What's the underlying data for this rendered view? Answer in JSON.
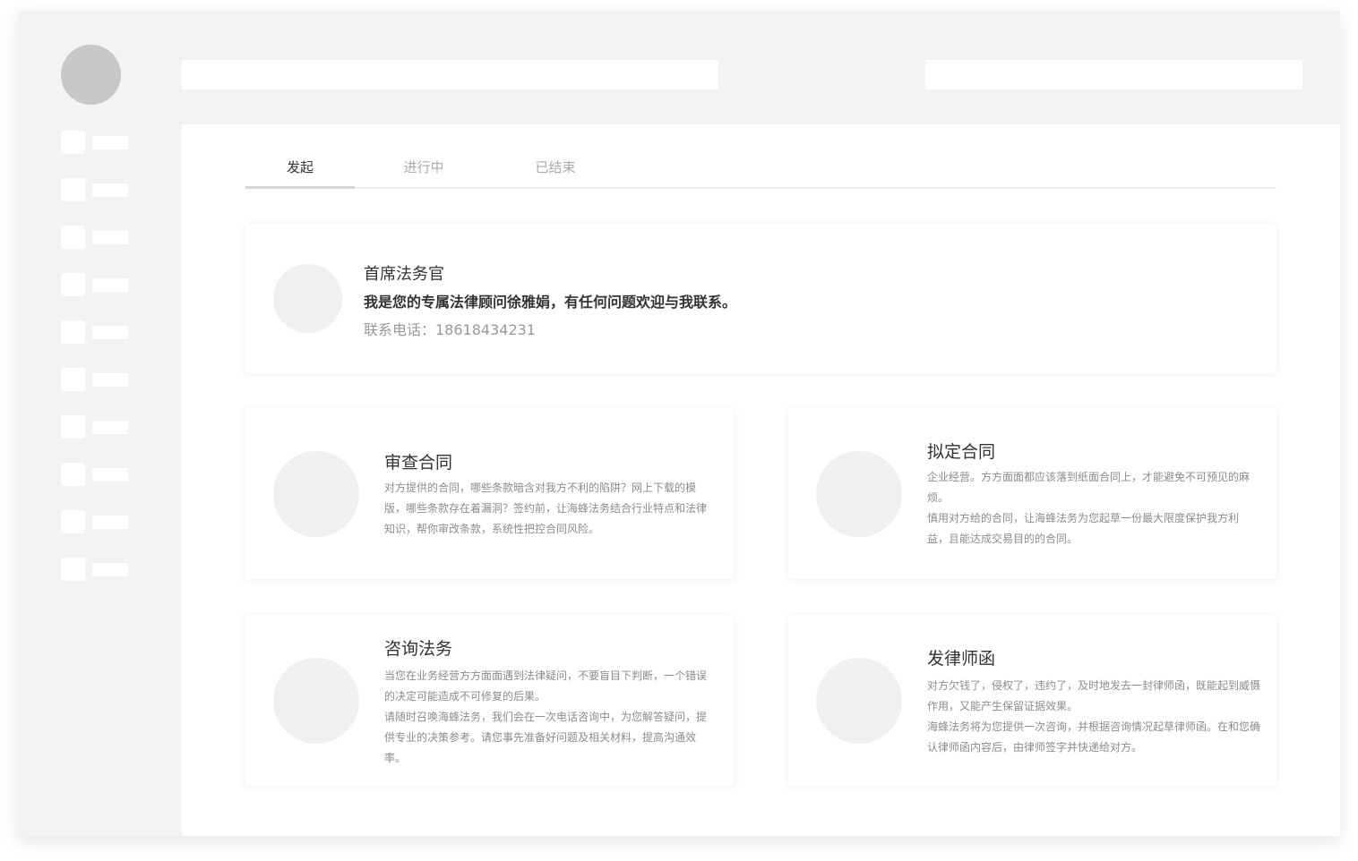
{
  "tabs": [
    {
      "label": "发起"
    },
    {
      "label": "进行中"
    },
    {
      "label": "已结束"
    }
  ],
  "profile": {
    "title": "首席法务官",
    "description": "我是您的专属法律顾问徐雅娟，有任何问题欢迎与我联系。",
    "phone": "联系电话：18618434231"
  },
  "services": [
    {
      "title": "审查合同",
      "paragraphs": [
        "对方提供的合同，哪些条款暗含对我方不利的陷阱？网上下载的模版，哪些条款存在着漏洞？签约前，让海蜂法务结合行业特点和法律知识，帮你审改条款，系统性把控合同风险。"
      ]
    },
    {
      "title": "拟定合同",
      "paragraphs": [
        "企业经营。方方面面都应该落到纸面合同上，才能避免不可预见的麻烦。",
        "慎用对方给的合同，让海蜂法务为您起草一份最大限度保护我方利益，且能达成交易目的的合同。"
      ]
    },
    {
      "title": "咨询法务",
      "paragraphs": [
        "当您在业务经营方方面面遇到法律疑问，不要盲目下判断，一个错误的决定可能造成不可修复的后果。",
        "请随时召唤海蜂法务，我们会在一次电话咨询中，为您解答疑问，提供专业的决策参考。请您事先准备好问题及相关材料，提高沟通效率。"
      ]
    },
    {
      "title": "发律师函",
      "paragraphs": [
        "对方欠钱了，侵权了，违约了，及时地发去一封律师函，既能起到威慑作用，又能产生保留证据效果。",
        "海蜂法务将为您提供一次咨询，并根据咨询情况起草律师函。在和您确认律师函内容后，由律师签字并快递给对方。"
      ]
    }
  ]
}
